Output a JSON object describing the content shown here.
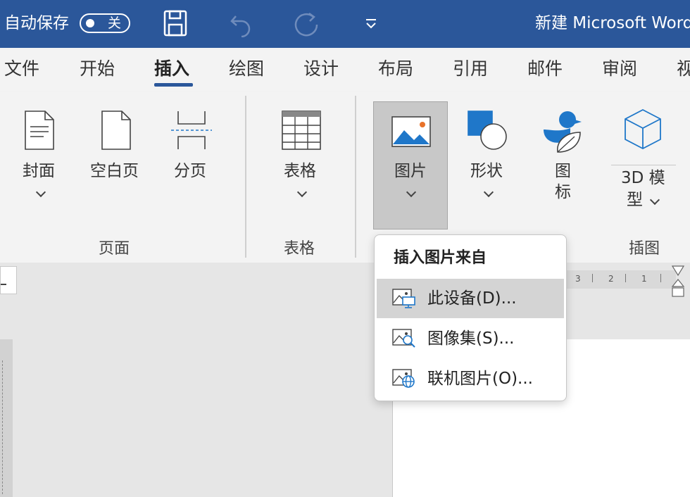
{
  "titlebar": {
    "autosave_label": "自动保存",
    "autosave_state": "关",
    "doc_title": "新建 Microsoft Word"
  },
  "tabs": [
    {
      "label": "文件"
    },
    {
      "label": "开始"
    },
    {
      "label": "插入",
      "active": true
    },
    {
      "label": "绘图"
    },
    {
      "label": "设计"
    },
    {
      "label": "布局"
    },
    {
      "label": "引用"
    },
    {
      "label": "邮件"
    },
    {
      "label": "审阅"
    },
    {
      "label": "视"
    }
  ],
  "ribbon": {
    "groups": [
      {
        "label": "页面",
        "buttons": [
          "封面",
          "空白页",
          "分页"
        ]
      },
      {
        "label": "表格",
        "buttons": [
          "表格"
        ]
      },
      {
        "label": "插图",
        "buttons": [
          "图片",
          "形状",
          "图",
          "标",
          "3D 模",
          "型"
        ]
      }
    ]
  },
  "dropdown": {
    "title": "插入图片来自",
    "items": [
      {
        "label": "此设备(D)...",
        "icon": "image-device-icon"
      },
      {
        "label": "图像集(S)...",
        "icon": "image-search-icon"
      },
      {
        "label": "联机图片(O)...",
        "icon": "image-online-icon"
      }
    ]
  },
  "ruler": {
    "numbers": [
      "3",
      "2",
      "1"
    ]
  },
  "colors": {
    "brand": "#2b579a",
    "ribbon_bg": "#f3f3f3",
    "icon_blue": "#1f77c9"
  }
}
